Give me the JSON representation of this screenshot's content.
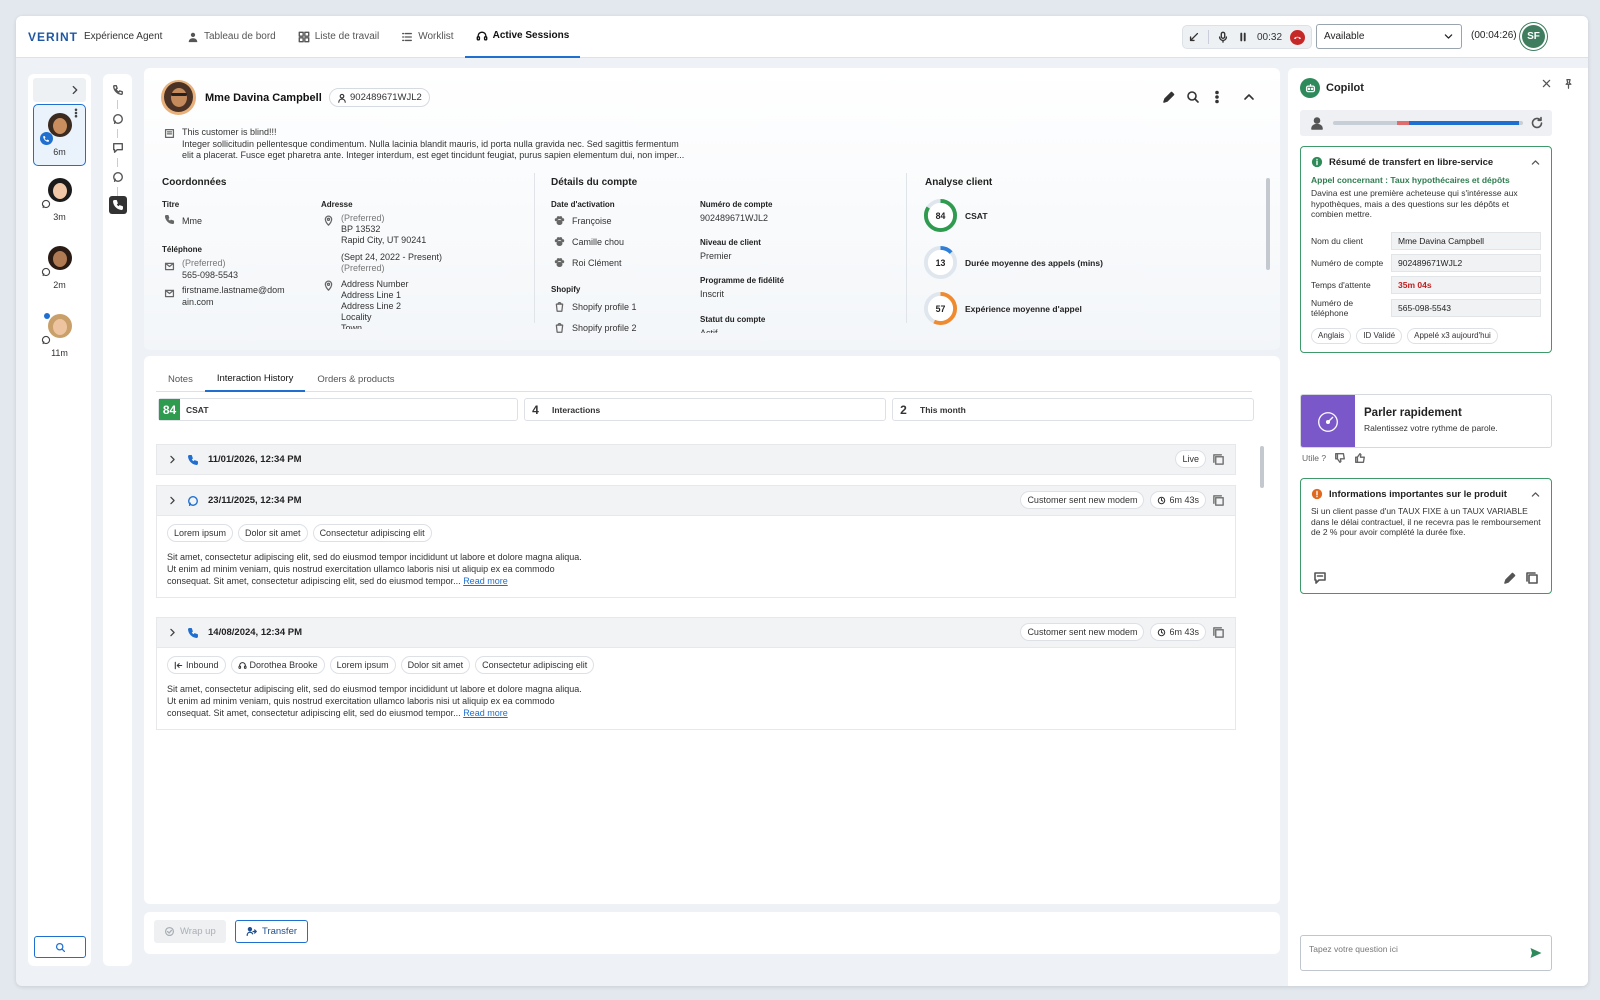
{
  "topbar": {
    "brand": "VERINT",
    "product": "Expérience Agent",
    "tabs": [
      {
        "label": "Tableau de bord",
        "icon": "person-icon"
      },
      {
        "label": "Liste de travail",
        "icon": "grid-icon"
      },
      {
        "label": "Worklist",
        "icon": "list-icon"
      },
      {
        "label": "Active Sessions",
        "icon": "headset-icon",
        "active": true
      }
    ],
    "call_timer": "00:32",
    "status": "Available",
    "session_timer": "(00:04:26)",
    "user_initials": "SF"
  },
  "sessions": [
    {
      "time": "6m",
      "channel": "phone",
      "active": true
    },
    {
      "time": "3m",
      "channel": "whatsapp"
    },
    {
      "time": "2m",
      "channel": "whatsapp"
    },
    {
      "time": "11m",
      "channel": "whatsapp",
      "unread": true
    }
  ],
  "customer": {
    "name": "Mme Davina Campbell",
    "id": "902489671WJL2",
    "note_line1": "This customer is blind!!!",
    "note_line2": "Integer sollicitudin pellentesque condimentum. Nulla lacinia blandit mauris, id porta nulla gravida nec. Sed sagittis fermentum",
    "note_line3": "elit a placerat. Fusce eget pharetra ante. Integer interdum, est eget tincidunt feugiat, purus sapien elementum dui, non imper...",
    "coords": {
      "heading": "Coordonnées",
      "title_label": "Titre",
      "title_value": "Mme",
      "phone_label": "Téléphone",
      "phone_pref": "(Preferred)",
      "phone": "565-098-5543",
      "email_l1": "firstname.lastname@dom",
      "email_l2": "ain.com",
      "address_label": "Adresse",
      "addr_pref": "(Preferred)",
      "addr_l1": "BP 13532",
      "addr_l2": "Rapid City, UT 90241",
      "addr_dates": "(Sept 24, 2022 - Present)",
      "addr2_pref": "(Preferred)",
      "addr2_l1": "Address Number",
      "addr2_l2": "Address Line 1",
      "addr2_l3": "Address Line 2",
      "addr2_l4": "Locality",
      "addr2_l5": "Town"
    },
    "account": {
      "heading": "Détails du compte",
      "activation_label": "Date d'activation",
      "pets": [
        "Françoise",
        "Camille chou",
        "Roi Clément"
      ],
      "shopify_label": "Shopify",
      "shopify": [
        "Shopify profile 1",
        "Shopify profile 2"
      ],
      "acct_num_label": "Numéro de compte",
      "acct_num": "902489671WJL2",
      "tier_label": "Niveau de client",
      "tier": "Premier",
      "loyalty_label": "Programme de fidélité",
      "loyalty": "Inscrit",
      "status_label": "Statut du compte",
      "status": "Actif"
    },
    "analysis": {
      "heading": "Analyse client",
      "metrics": [
        {
          "value": 84,
          "label": "CSAT",
          "color": "#2e9b4f"
        },
        {
          "value": 13,
          "label": "Durée moyenne des appels (mins)",
          "color": "#2f7fd8"
        },
        {
          "value": 57,
          "label": "Expérience moyenne d'appel",
          "color": "#f08a2e"
        }
      ]
    }
  },
  "history": {
    "tabs": [
      "Notes",
      "Interaction History",
      "Orders & products"
    ],
    "stats": [
      {
        "value": "84",
        "label": "CSAT"
      },
      {
        "value": "4",
        "label": "Interactions"
      },
      {
        "value": "2",
        "label": "This month"
      }
    ],
    "rows": [
      {
        "date": "11/01/2026, 12:34 PM",
        "channel": "phone",
        "badge": "Live"
      },
      {
        "date": "23/11/2025, 12:34 PM",
        "channel": "whatsapp",
        "badge": "Customer sent new modem",
        "duration": "6m 43s",
        "chips": [
          "Lorem ipsum",
          "Dolor sit amet",
          "Consectetur adipiscing elit"
        ],
        "text_l1": "Sit amet, consectetur adipiscing elit, sed do eiusmod tempor incididunt ut labore et dolore magna aliqua.",
        "text_l2": "Ut enim ad minim veniam, quis nostrud exercitation ullamco laboris nisi ut aliquip ex ea commodo",
        "text_l3": "consequat. Sit amet, consectetur adipiscing elit, sed do eiusmod tempor...",
        "more": "Read more"
      },
      {
        "date": "14/08/2024, 12:34 PM",
        "channel": "phone",
        "badge": "Customer sent new modem",
        "duration": "6m 43s",
        "chip_inbound": "Inbound",
        "chip_agent": "Dorothea Brooke",
        "chips": [
          "Lorem ipsum",
          "Dolor sit amet",
          "Consectetur adipiscing elit"
        ],
        "text_l1": "Sit amet, consectetur adipiscing elit, sed do eiusmod tempor incididunt ut labore et dolore magna aliqua.",
        "text_l2": "Ut enim ad minim veniam, quis nostrud exercitation ullamco laboris nisi ut aliquip ex ea commodo",
        "text_l3": "consequat. Sit amet, consectetur adipiscing elit, sed do eiusmod tempor...",
        "more": "Read more"
      }
    ]
  },
  "actions": {
    "wrap_up": "Wrap up",
    "transfer": "Transfer"
  },
  "copilot": {
    "title": "Copilot",
    "summary": {
      "title": "Résumé de transfert en libre-service",
      "subtitle": "Appel concernant : Taux hypothécaires et dépôts",
      "text": "Davina est une première acheteuse qui s'intéresse aux hypothèques, mais a des questions sur les dépôts et combien mettre.",
      "fields": [
        {
          "label": "Nom du client",
          "value": "Mme Davina Campbell"
        },
        {
          "label": "Numéro de compte",
          "value": "902489671WJL2"
        },
        {
          "label": "Temps d'attente",
          "value": "35m 04s",
          "alert": true
        },
        {
          "label": "Numéro de téléphone",
          "value": "565-098-5543"
        }
      ],
      "tags": [
        "Anglais",
        "ID Validé",
        "Appelé x3 aujourd'hui"
      ]
    },
    "speak": {
      "title": "Parler rapidement",
      "text": "Ralentissez votre rythme de parole."
    },
    "useful": "Utile ?",
    "product_info": {
      "title": "Informations importantes sur le produit",
      "text": "Si un client passe d'un TAUX FIXE à un TAUX VARIABLE dans le délai contractuel, il ne recevra pas le remboursement de 2 % pour avoir complété la durée fixe."
    },
    "ask_placeholder": "Tapez votre question ici"
  }
}
